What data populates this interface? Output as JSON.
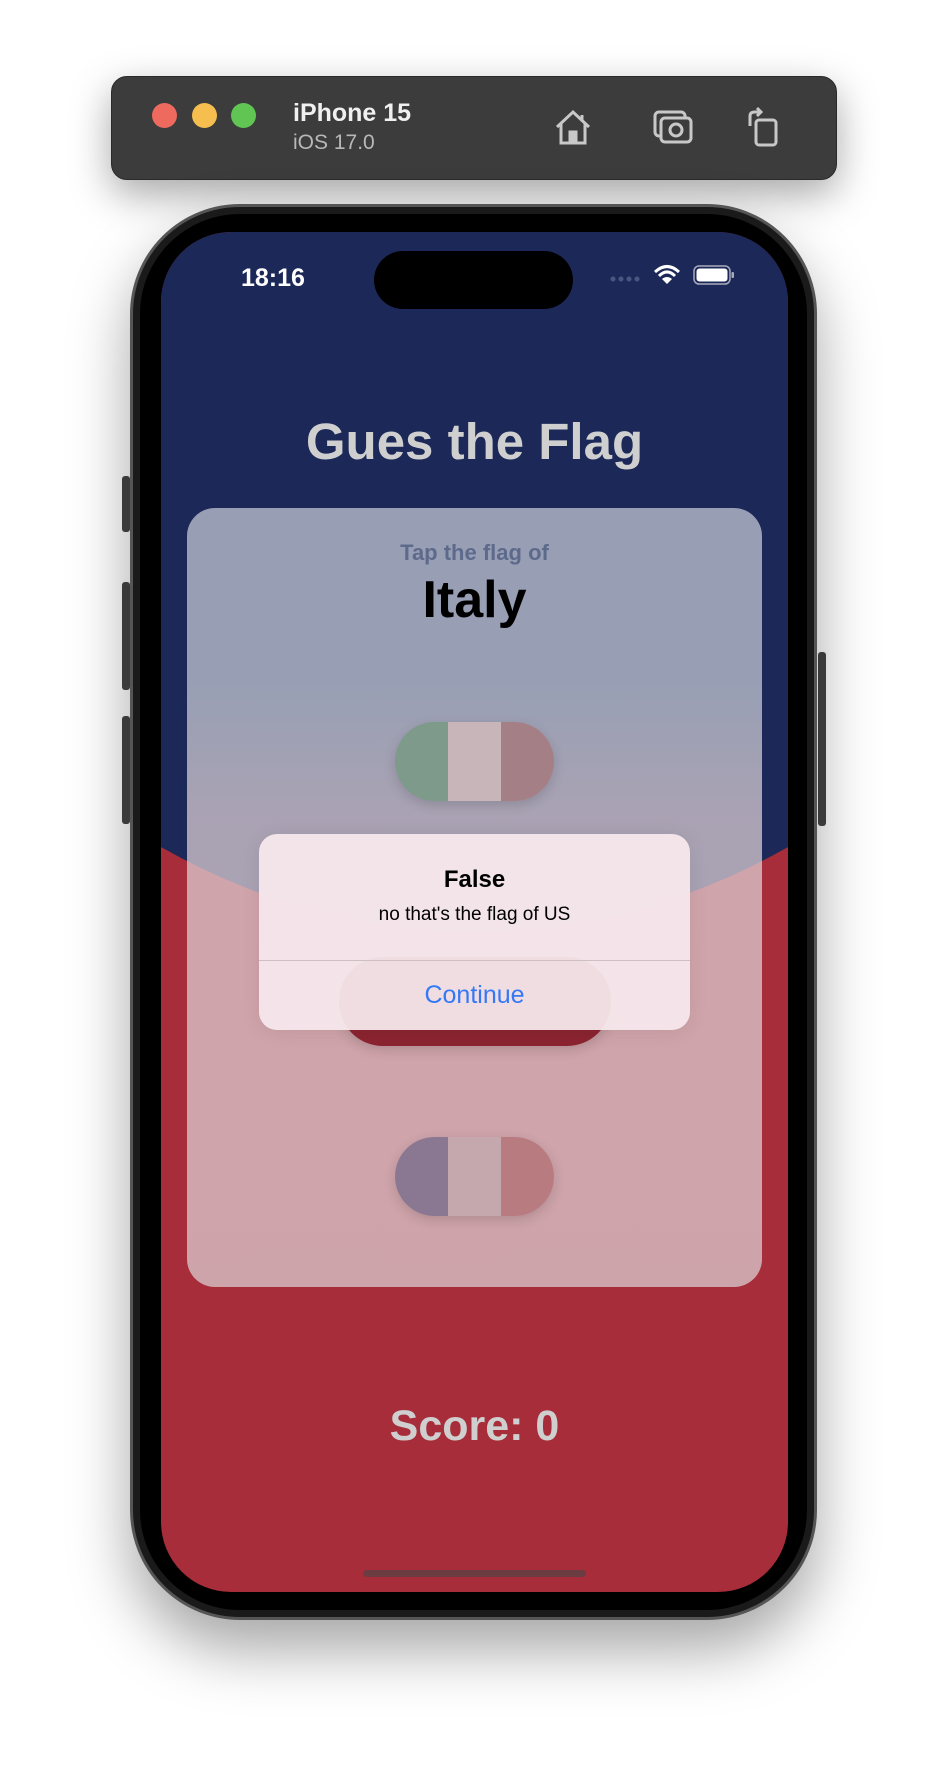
{
  "simulator": {
    "device_name": "iPhone 15",
    "os_version": "iOS 17.0",
    "traffic_lights": {
      "close": "#ee6a5f",
      "minimize": "#f5be4f",
      "zoom": "#61c554"
    },
    "icons": [
      "home-icon",
      "screenshot-camera-icon",
      "rotate-icon"
    ]
  },
  "status_bar": {
    "time": "18:16",
    "icons": [
      "cellular-dots-icon",
      "wifi-icon",
      "battery-icon"
    ]
  },
  "app": {
    "title": "Gues the Flag",
    "prompt": "Tap the flag of",
    "country": "Italy",
    "flags": [
      {
        "colors": [
          "#7d9a8a",
          "#c7b5ba",
          "#a57f86"
        ]
      },
      {
        "colors": [
          "#c33",
          "#ddd",
          "#8b2430"
        ]
      },
      {
        "colors": [
          "#8a7892",
          "#c4a8ae",
          "#b87b80"
        ]
      }
    ],
    "score_label": "Score: 0",
    "colors": {
      "top": "#1b2858",
      "bottom": "#a62d39"
    }
  },
  "alert": {
    "title": "False",
    "message": "no that's the flag of US",
    "button": "Continue",
    "button_color": "#3478f6"
  }
}
